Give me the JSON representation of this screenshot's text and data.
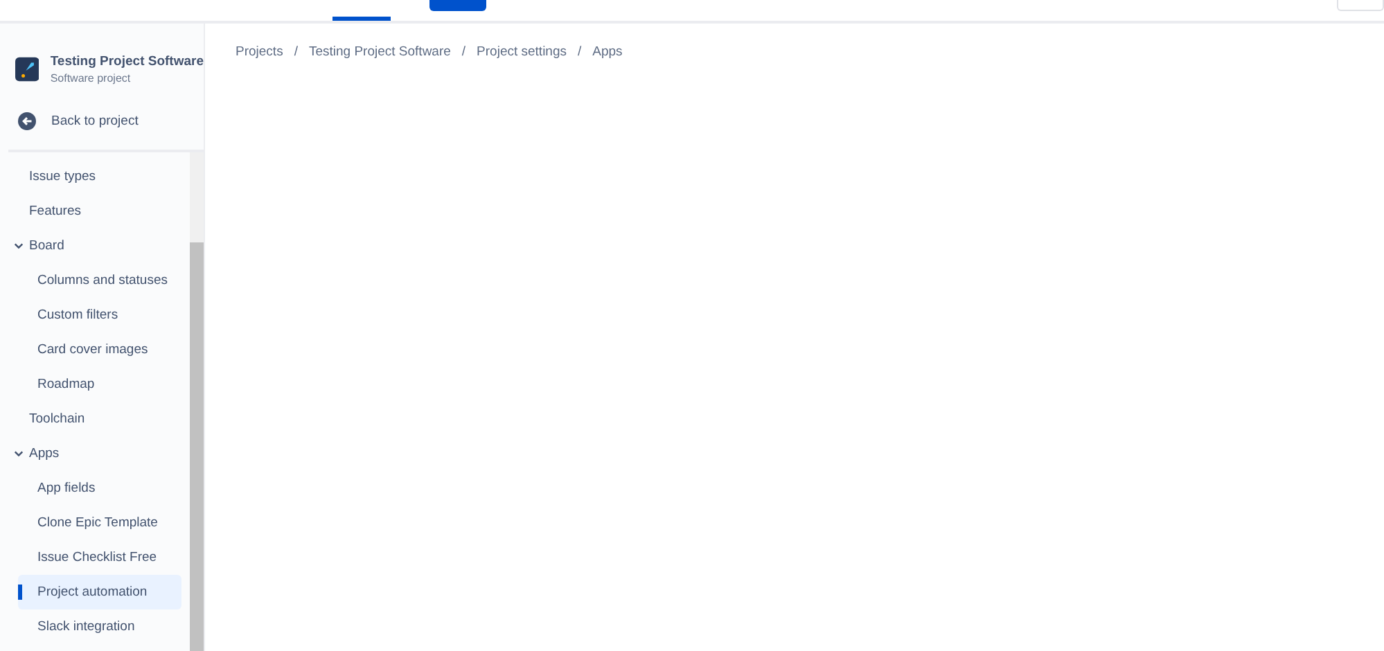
{
  "sidebar": {
    "project": {
      "name": "Testing Project Software",
      "type": "Software project"
    },
    "back_link": "Back to project",
    "items": [
      {
        "label": "Issue types",
        "selected": false
      },
      {
        "label": "Features",
        "selected": false
      },
      {
        "label": "Board",
        "selected": false,
        "expanded": true,
        "children": [
          {
            "label": "Columns and statuses",
            "selected": false
          },
          {
            "label": "Custom filters",
            "selected": false
          },
          {
            "label": "Card cover images",
            "selected": false
          },
          {
            "label": "Roadmap",
            "selected": false
          }
        ]
      },
      {
        "label": "Toolchain",
        "selected": false
      },
      {
        "label": "Apps",
        "selected": false,
        "expanded": true,
        "children": [
          {
            "label": "App fields",
            "selected": false
          },
          {
            "label": "Clone Epic Template",
            "selected": false
          },
          {
            "label": "Issue Checklist Free",
            "selected": false
          },
          {
            "label": "Project automation",
            "selected": true
          },
          {
            "label": "Slack integration",
            "selected": false
          }
        ]
      }
    ]
  },
  "breadcrumbs": [
    {
      "label": "Projects"
    },
    {
      "separator": "/",
      "label": "Testing Project Software"
    },
    {
      "separator": "/",
      "label": "Project settings"
    },
    {
      "separator": "/",
      "label": "Apps"
    }
  ]
}
